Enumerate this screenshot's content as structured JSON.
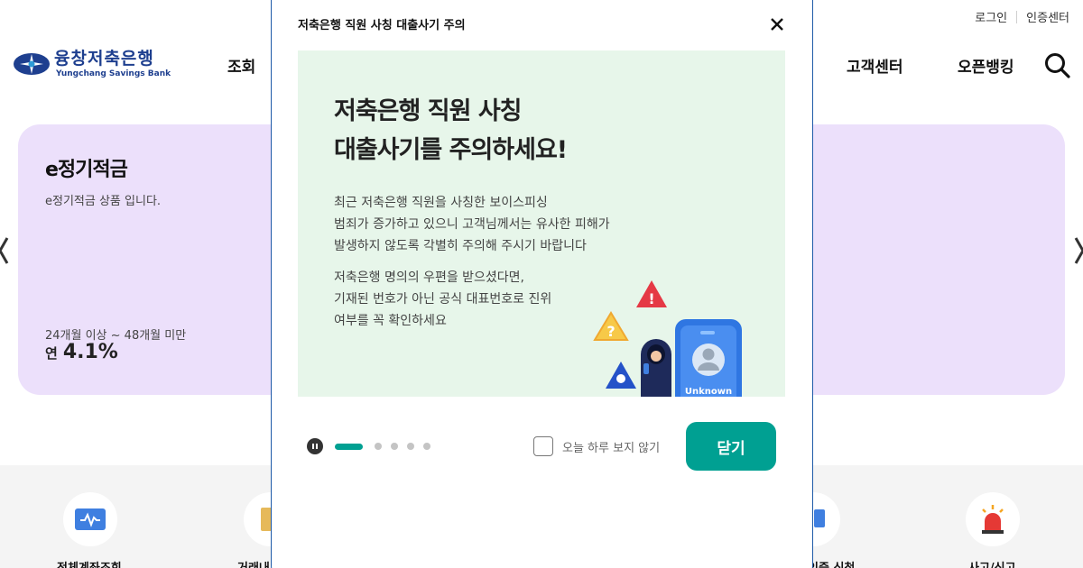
{
  "utility": {
    "login": "로그인",
    "certcenter": "인증센터"
  },
  "logo": {
    "name_ko": "융창저축은행",
    "name_en": "Yungchang Savings Bank"
  },
  "nav": {
    "item1": "조회",
    "customer_center": "고객센터",
    "open_banking": "오픈뱅킹"
  },
  "icons": {
    "search": "search-icon",
    "prev": "chevron-left-icon",
    "next": "chevron-right-icon",
    "close": "close-icon",
    "pause": "pause-icon"
  },
  "banner": {
    "title": "e정기적금",
    "description": "e정기적금 상품 입니다.",
    "term": "24개월 이상 ~ 48개월 미만",
    "rate_prefix": "연",
    "rate": "4.1%",
    "background": "#ece0fb"
  },
  "quickmenu": {
    "item1": "전체계좌조회",
    "item2": "거래내",
    "item3": "인증 신청",
    "item4": "사고/신고"
  },
  "modal": {
    "title": "저축은행 직원 사칭 대출사기 주의",
    "headline1": "저축은행 직원 사칭",
    "headline2": "대출사기를 주의하세요!",
    "body1_line1": "최근 저축은행 직원을 사칭한 보이스피싱",
    "body1_line2": "범죄가 증가하고 있으니 고객님께서는 유사한 피해가",
    "body1_line3": "발생하지 않도록 각별히 주의해 주시기 바랍니다",
    "body2_line1": "저축은행 명의의 우편을 받으셨다면,",
    "body2_line2": "기재된 번호가 아닌 공식 대표번호로 진위",
    "body2_line3": "여부를 꼭 확인하세요",
    "phone_caller": "Unknown",
    "dont_show_today": "오늘 하루 보지 않기",
    "close_label": "닫기",
    "accent": "#00a092",
    "notice_bg": "#e7f6ea",
    "slide_current": 1,
    "slide_total": 5
  }
}
